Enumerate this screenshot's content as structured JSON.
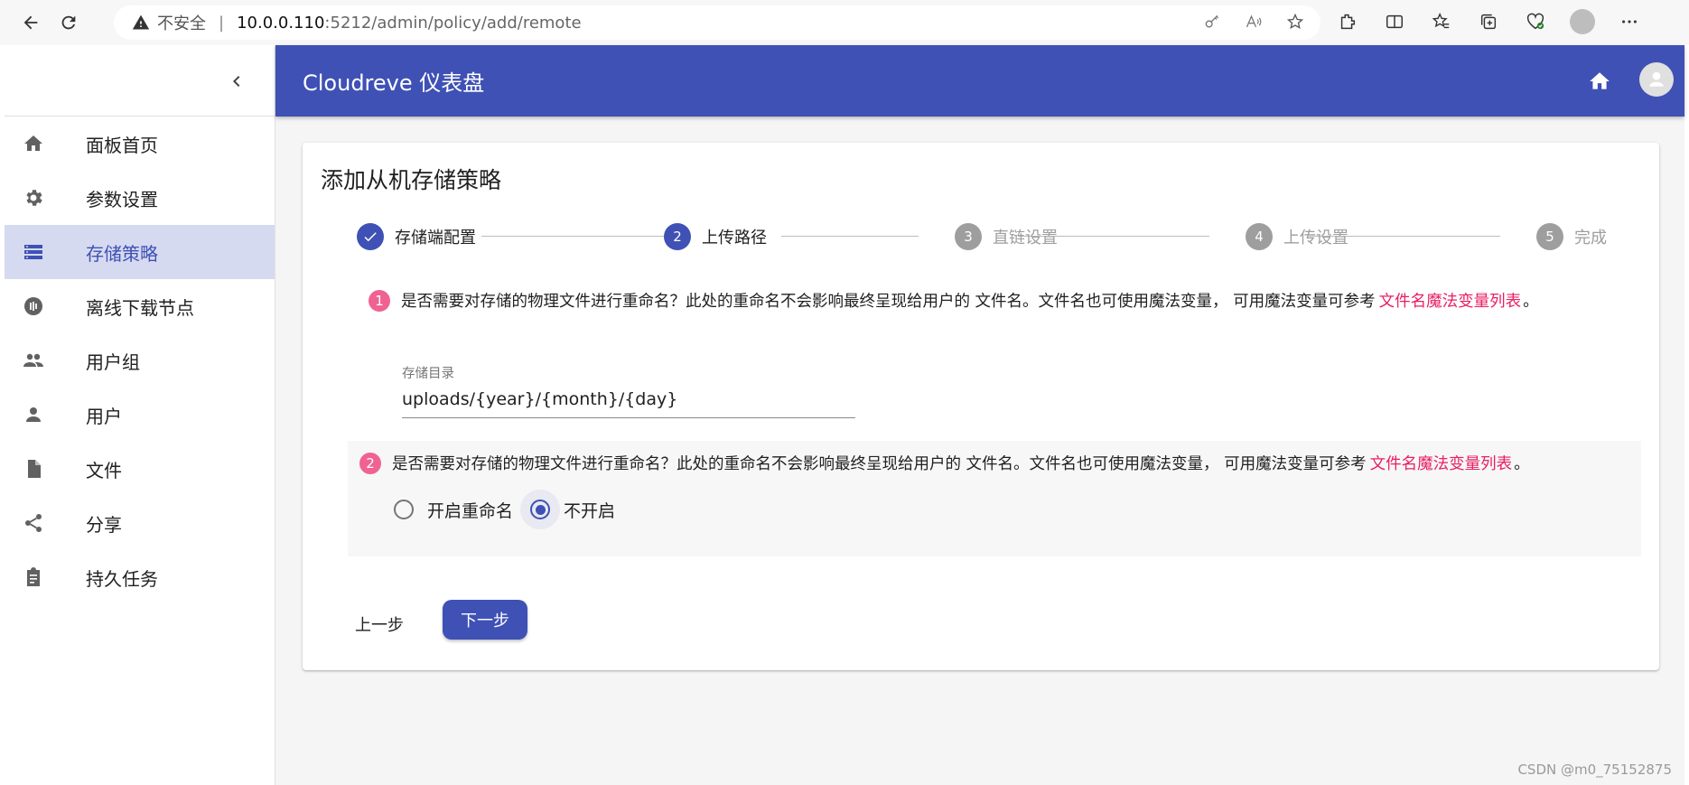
{
  "browser": {
    "security_label": "不安全",
    "url_host": "10.0.0.110",
    "url_path": ":5212/admin/policy/add/remote"
  },
  "sidebar": {
    "items": [
      {
        "label": "面板首页",
        "icon": "home-icon"
      },
      {
        "label": "参数设置",
        "icon": "gear-icon"
      },
      {
        "label": "存储策略",
        "icon": "storage-icon",
        "active": true
      },
      {
        "label": "离线下载节点",
        "icon": "download-node-icon"
      },
      {
        "label": "用户组",
        "icon": "group-icon"
      },
      {
        "label": "用户",
        "icon": "person-icon"
      },
      {
        "label": "文件",
        "icon": "file-icon"
      },
      {
        "label": "分享",
        "icon": "share-icon"
      },
      {
        "label": "持久任务",
        "icon": "task-icon"
      }
    ]
  },
  "appbar": {
    "title": "Cloudreve 仪表盘"
  },
  "card": {
    "title": "添加从机存储策略"
  },
  "stepper": {
    "steps": [
      {
        "num": "1",
        "label": "存储端配置",
        "state": "done"
      },
      {
        "num": "2",
        "label": "上传路径",
        "state": "active"
      },
      {
        "num": "3",
        "label": "直链设置",
        "state": "pending"
      },
      {
        "num": "4",
        "label": "上传设置",
        "state": "pending"
      },
      {
        "num": "5",
        "label": "完成",
        "state": "pending"
      }
    ]
  },
  "question1": {
    "num": "1",
    "text": "是否需要对存储的物理文件进行重命名？此处的重命名不会影响最终呈现给用户的 文件名。文件名也可使用魔法变量， 可用魔法变量可参考",
    "link": "文件名魔法变量列表",
    "end": "。"
  },
  "dir_field": {
    "label": "存储目录",
    "value": "uploads/{year}/{month}/{day}"
  },
  "question2": {
    "num": "2",
    "text": "是否需要对存储的物理文件进行重命名？此处的重命名不会影响最终呈现给用户的 文件名。文件名也可使用魔法变量， 可用魔法变量可参考",
    "link": "文件名魔法变量列表",
    "end": " 。",
    "options": [
      {
        "label": "开启重命名",
        "checked": false
      },
      {
        "label": "不开启",
        "checked": true
      }
    ]
  },
  "buttons": {
    "back": "上一步",
    "next": "下一步"
  },
  "watermark": "CSDN @m0_75152875",
  "colors": {
    "primary": "#3f51b5",
    "accent": "#e91e63",
    "badge": "#f06292",
    "active_bg": "#d6daf0"
  }
}
